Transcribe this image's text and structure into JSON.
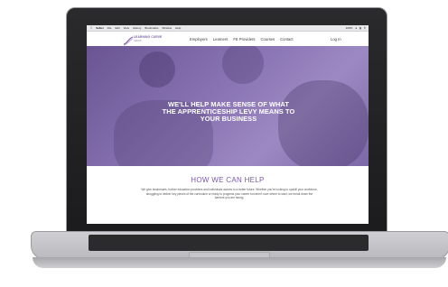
{
  "menubar": {
    "apple": "",
    "app_name": "Safari",
    "items": [
      "File",
      "Edit",
      "View",
      "History",
      "Bookmarks",
      "Window",
      "Help"
    ],
    "right_items": [
      "100%",
      "Wi-Fi",
      "Battery"
    ]
  },
  "site": {
    "logo": {
      "name": "LEARNING CURVE",
      "sub": "GROUP"
    },
    "nav": [
      "Employers",
      "Learners",
      "FE Providers",
      "Courses",
      "Contact"
    ],
    "login": "Log In",
    "hero_title": "WE'LL HELP MAKE SENSE OF WHAT THE APPRENTICESHIP LEVY MEANS TO YOUR BUSINESS",
    "section_title": "HOW WE CAN HELP",
    "section_body": "We give businesses, further education providers and individuals access to a better future. Whether you're looking to upskill your workforce, struggling to deliver key pieces of the curriculum or ready to progress your career but aren't sure where to start, we break down the barriers you are facing."
  },
  "colors": {
    "accent": "#7a5aa6",
    "hero_overlay": "#8a74b4"
  }
}
